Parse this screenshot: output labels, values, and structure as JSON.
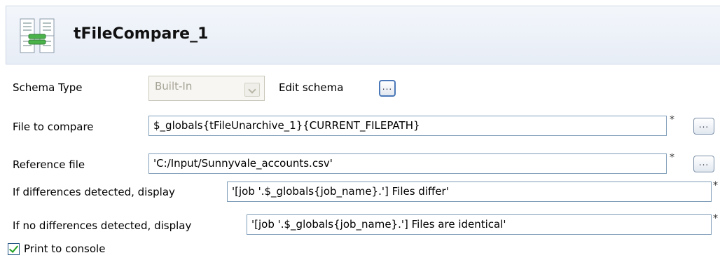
{
  "header": {
    "title": "tFileCompare_1",
    "icon": "file-compare-icon"
  },
  "schema": {
    "label": "Schema Type",
    "type_value": "Built-In",
    "edit_label": "Edit schema",
    "edit_button": "..."
  },
  "file_to_compare": {
    "label": "File to compare",
    "value": "$_globals{tFileUnarchive_1}{CURRENT_FILEPATH}",
    "required_mark": "*",
    "browse": "..."
  },
  "reference_file": {
    "label": "Reference file",
    "value": "'C:/Input/Sunnyvale_accounts.csv'",
    "required_mark": "*",
    "browse": "..."
  },
  "diff_message": {
    "label": "If differences detected, display",
    "value": "'[job '.$_globals{job_name}.'] Files differ'",
    "required_mark": "*"
  },
  "same_message": {
    "label": "If no differences detected, display",
    "value": "'[job '.$_globals{job_name}.'] Files are identical'",
    "required_mark": "*"
  },
  "print_to_console": {
    "label": "Print to console",
    "checked": true
  }
}
